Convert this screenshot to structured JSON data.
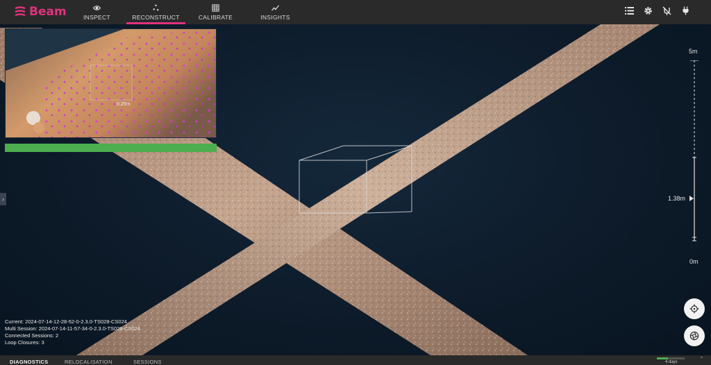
{
  "app": {
    "brand": "Beam",
    "brand_color": "#e0327e"
  },
  "nav": {
    "tabs": [
      {
        "label": "INSPECT",
        "icon": "eye-icon",
        "active": false
      },
      {
        "label": "RECONSTRUCT",
        "icon": "scatter-dots-icon",
        "active": true
      },
      {
        "label": "CALIBRATE",
        "icon": "grid-icon",
        "active": false
      },
      {
        "label": "INSIGHTS",
        "icon": "trend-line-icon",
        "active": false
      }
    ]
  },
  "toolbar_icons": [
    "layers-list-icon",
    "gear-icon",
    "no-connection-icon",
    "power-plug-icon"
  ],
  "camera": {
    "measurement": "0.25m",
    "progress": 1.0
  },
  "scale": {
    "top": "5m",
    "mid": "1.38m",
    "bottom": "0m"
  },
  "info": {
    "current": "Current: 2024-07-14-12-28-52-0-2.3.0-TS028-CS024",
    "multi": "Multi Session: 2024-07-14-11-57-34-0-2.3.0-TS028-CS024",
    "connected": "Connected Sessions: 2",
    "loops": "Loop Closures: 3"
  },
  "bottom": {
    "tabs": [
      {
        "label": "DIAGNOSTICS",
        "active": true
      },
      {
        "label": "RELOCALISATION",
        "active": false
      },
      {
        "label": "SESSIONS",
        "active": false
      }
    ],
    "days_label": "4 days",
    "storage_progress": 0.4
  },
  "colors": {
    "progress": "#4cae4f",
    "accent": "#e0327e",
    "background": "#0b1622"
  }
}
